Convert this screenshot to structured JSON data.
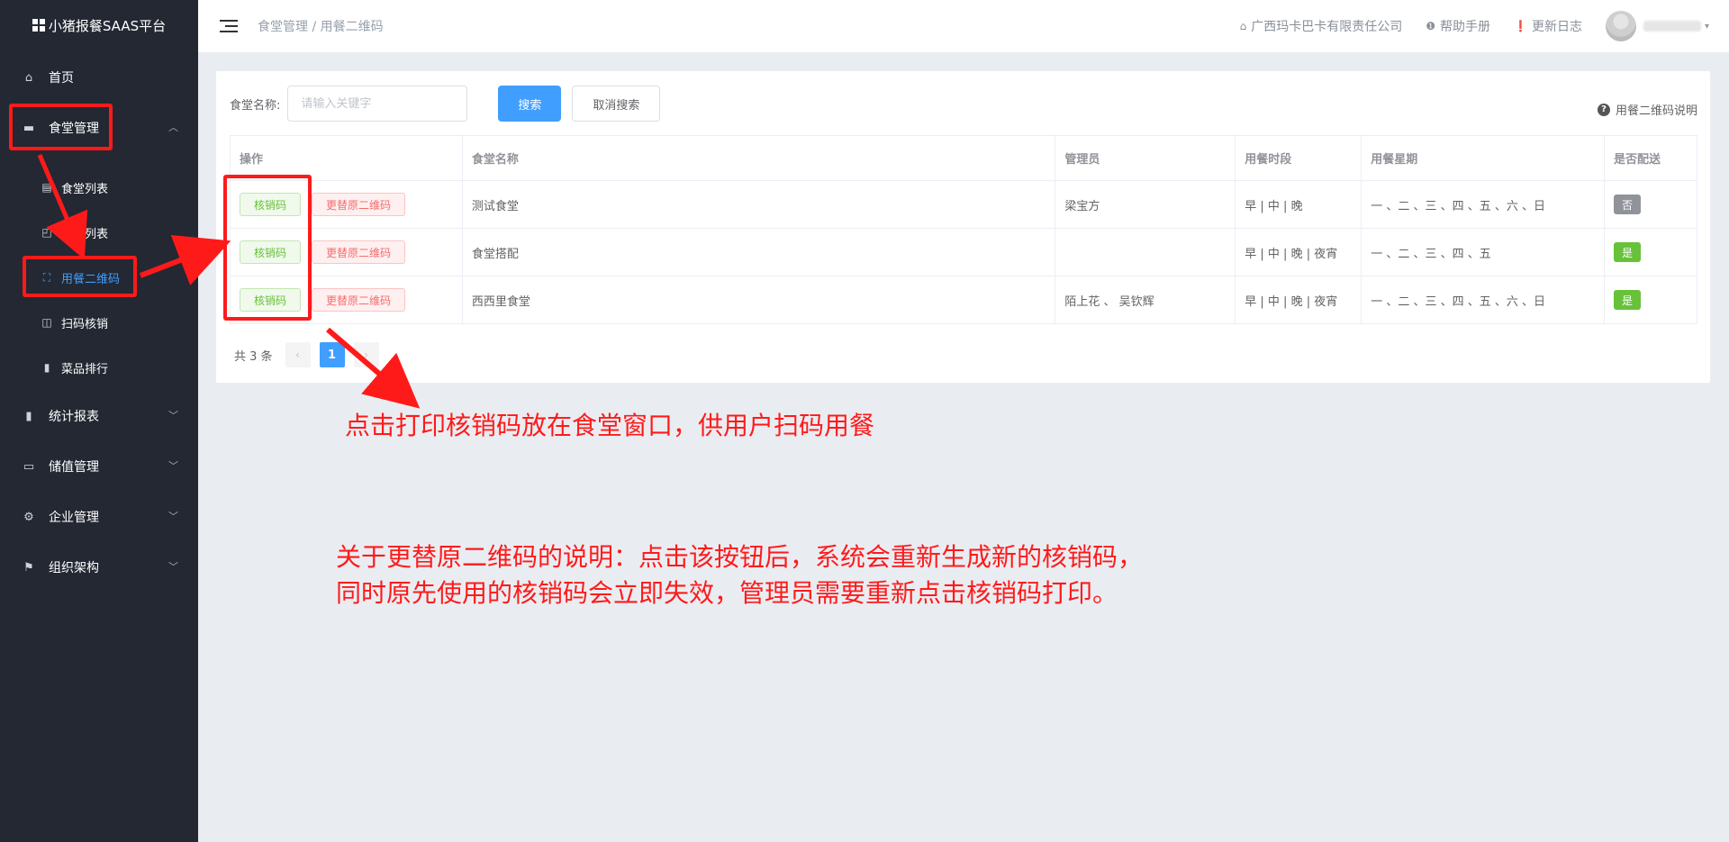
{
  "app": {
    "title": "小猪报餐SAAS平台"
  },
  "sidebar": {
    "items": [
      {
        "label": "首页",
        "icon": "home-icon"
      },
      {
        "label": "食堂管理",
        "icon": "canteen-icon"
      },
      {
        "label": "统计报表",
        "icon": "chart-icon"
      },
      {
        "label": "储值管理",
        "icon": "card-icon"
      },
      {
        "label": "企业管理",
        "icon": "gear-icon"
      },
      {
        "label": "组织架构",
        "icon": "flag-icon"
      }
    ],
    "sub_items": [
      {
        "label": "食堂列表",
        "icon": "document-icon"
      },
      {
        "label": "采购列表",
        "icon": "bag-icon"
      },
      {
        "label": "用餐二维码",
        "icon": "scan-icon"
      },
      {
        "label": "扫码核销",
        "icon": "scan-verify-icon"
      },
      {
        "label": "菜品排行",
        "icon": "ranking-icon"
      }
    ]
  },
  "header": {
    "breadcrumb": "食堂管理 / 用餐二维码",
    "company": "广西玛卡巴卡有限责任公司",
    "help": "帮助手册",
    "changelog": "更新日志"
  },
  "search": {
    "label": "食堂名称:",
    "placeholder": "请输入关键字",
    "search_button": "搜索",
    "cancel_button": "取消搜索",
    "help_link": "用餐二维码说明"
  },
  "table": {
    "columns": [
      "操作",
      "食堂名称",
      "管理员",
      "用餐时段",
      "用餐星期",
      "是否配送"
    ],
    "actions": {
      "verify": "核销码",
      "replace": "更替原二维码"
    },
    "rows": [
      {
        "name": "测试食堂",
        "admin": "梁宝方",
        "periods": "早 | 中 | 晚",
        "weekdays": "一 、二 、三 、四 、五 、六 、日",
        "delivery": "否"
      },
      {
        "name": "食堂搭配",
        "admin": "",
        "periods": "早 | 中 | 晚 | 夜宵",
        "weekdays": "一 、二 、三 、四 、五",
        "delivery": "是"
      },
      {
        "name": "西西里食堂",
        "admin": "陌上花 、 吴钦辉",
        "periods": "早 | 中 | 晚 | 夜宵",
        "weekdays": "一 、二 、三 、四 、五 、六 、日",
        "delivery": "是"
      }
    ]
  },
  "pagination": {
    "total": "共 3 条",
    "current": "1"
  },
  "annotations": {
    "note1": "点击打印核销码放在食堂窗口，供用户扫码用餐",
    "note2_line1": "关于更替原二维码的说明：点击该按钮后，系统会重新生成新的核销码，",
    "note2_line2": "同时原先使用的核销码会立即失效，管理员需要重新点击核销码打印。"
  },
  "colors": {
    "accent": "#409eff",
    "annotation": "#ff1a1a",
    "sidebar_bg": "#232833"
  }
}
